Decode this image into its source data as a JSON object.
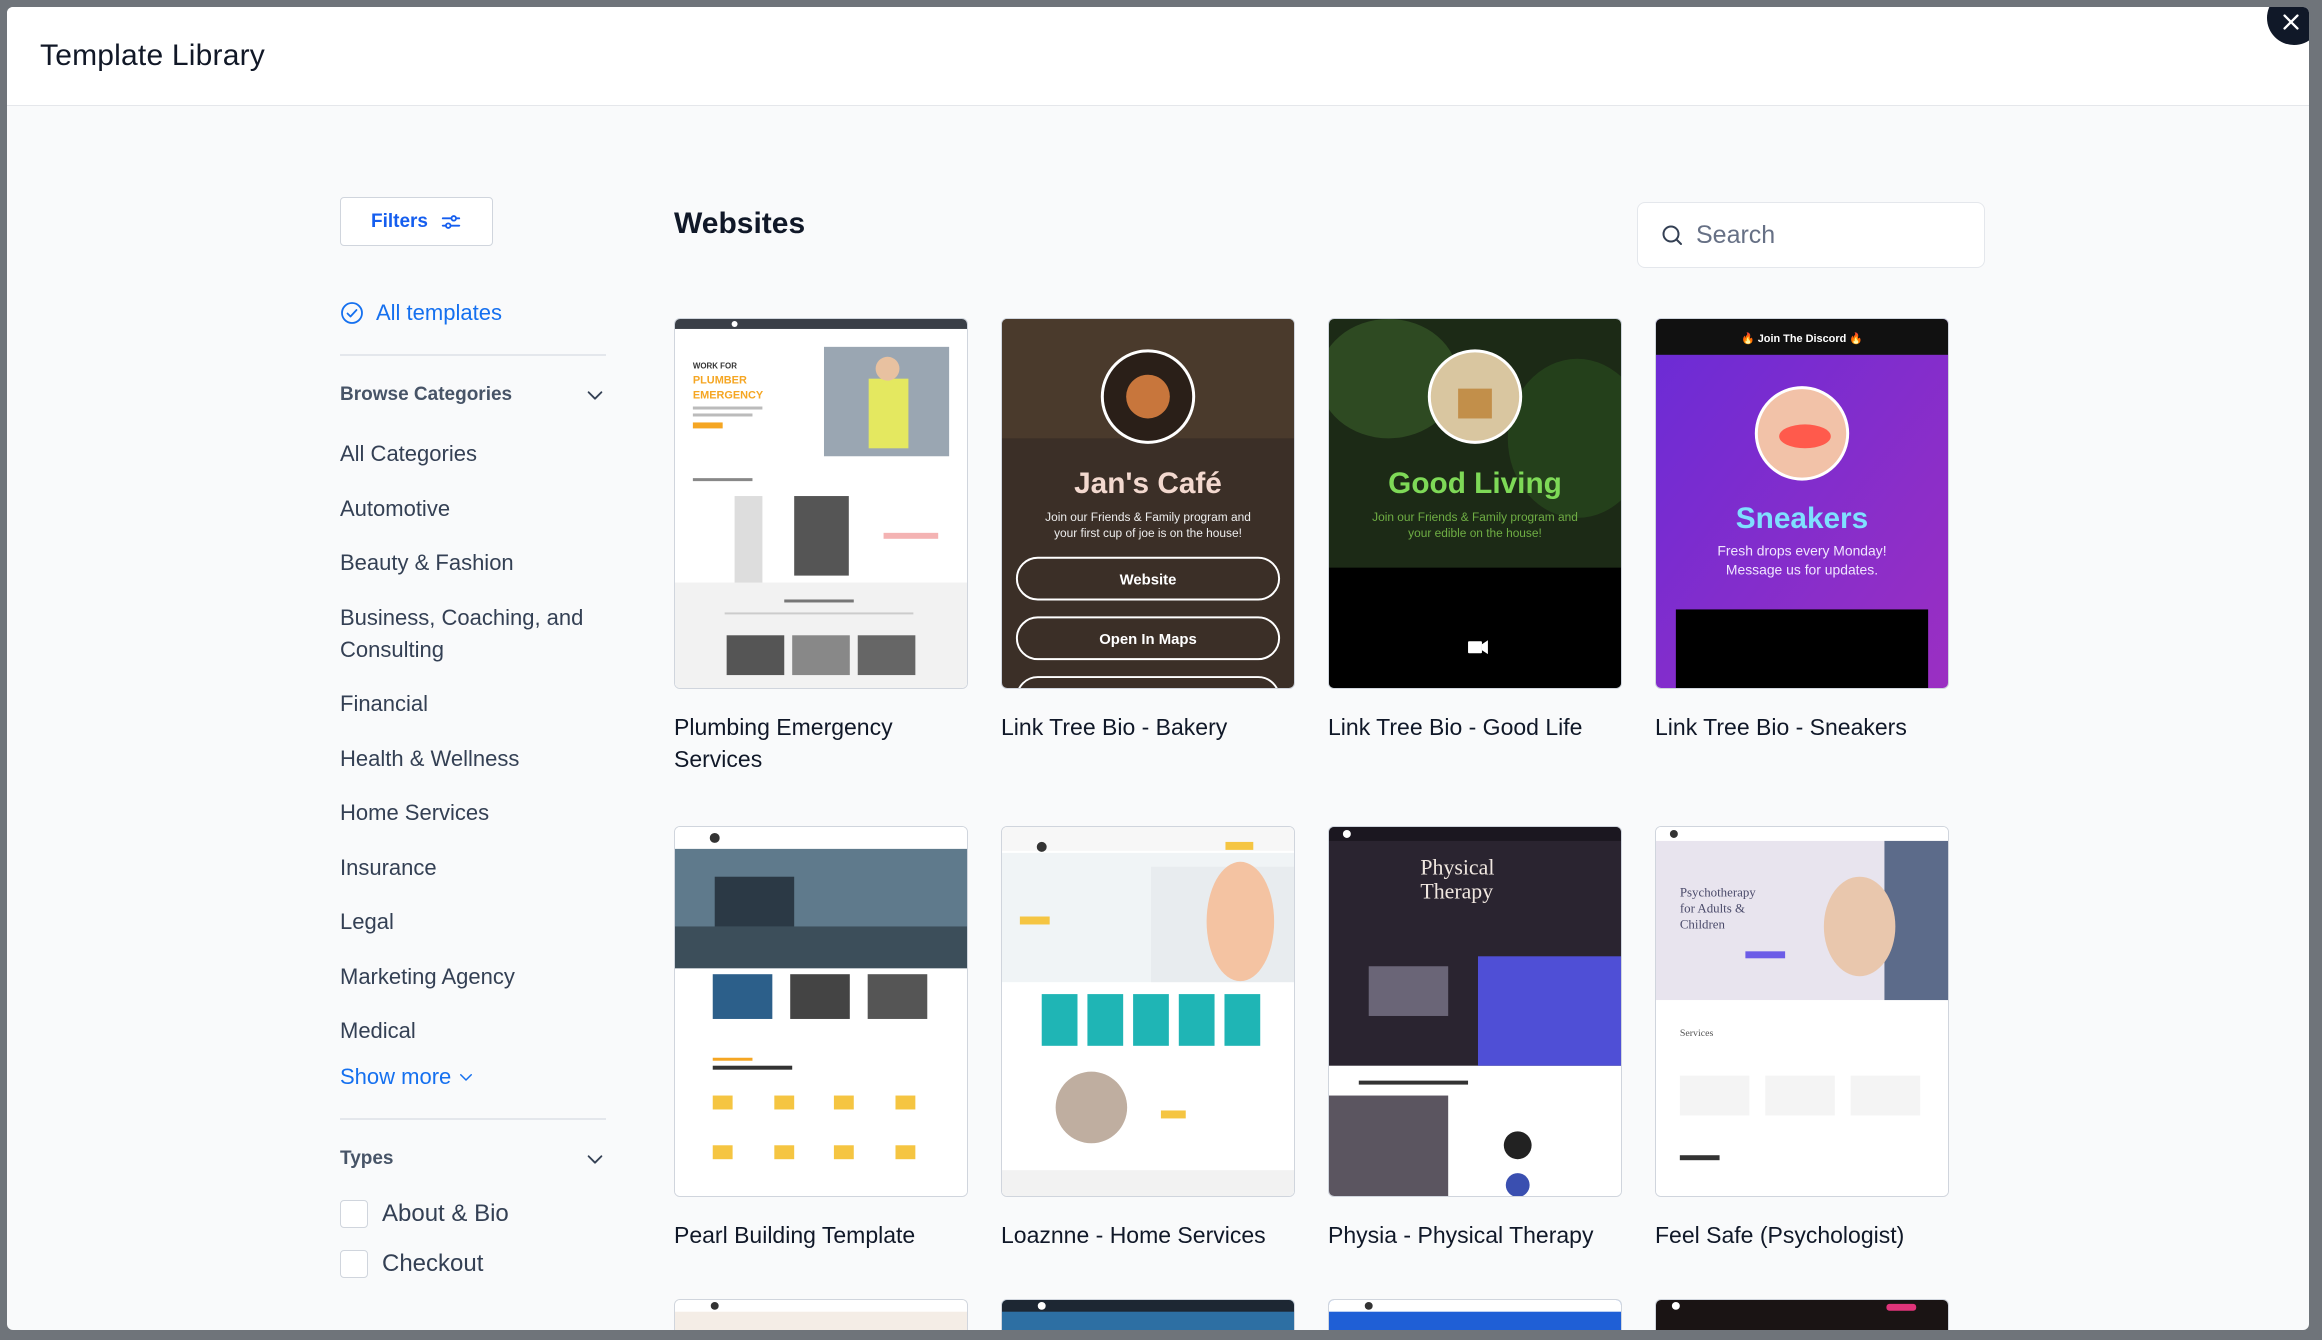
{
  "modal": {
    "title": "Template Library"
  },
  "sidebar": {
    "filters_label": "Filters",
    "all_templates_label": "All templates",
    "browse_categories_label": "Browse Categories",
    "categories": [
      "All Categories",
      "Automotive",
      "Beauty & Fashion",
      "Business, Coaching, and Consulting",
      "Financial",
      "Health & Wellness",
      "Home Services",
      "Insurance",
      "Legal",
      "Marketing Agency",
      "Medical"
    ],
    "show_more_label": "Show more",
    "types_label": "Types",
    "types": [
      "About & Bio",
      "Checkout"
    ]
  },
  "main": {
    "section_title": "Websites",
    "search_placeholder": "Search",
    "templates": [
      {
        "title": "Plumbing Emergency Services",
        "thumb_text": [
          "WORK FOR",
          "PLUMBER",
          "EMERGENCY"
        ]
      },
      {
        "title": "Link Tree Bio - Bakery",
        "thumb_text": [
          "Jan's Café",
          "Join our Friends & Family program and",
          "your first cup of joe is on the house!",
          "Website",
          "Open In Maps"
        ]
      },
      {
        "title": "Link Tree Bio - Good Life",
        "thumb_text": [
          "Good Living",
          "Join our Friends & Family program and",
          "your edible on the house!"
        ]
      },
      {
        "title": "Link Tree Bio - Sneakers",
        "thumb_text": [
          "🔥 Join The Discord 🔥",
          "Sneakers",
          "Fresh drops every Monday!",
          "Message us for updates."
        ]
      },
      {
        "title": "Pearl Building Template",
        "thumb_text": []
      },
      {
        "title": "Loaznne - Home Services",
        "thumb_text": []
      },
      {
        "title": "Physia - Physical Therapy",
        "thumb_text": [
          "Physical",
          "Therapy"
        ]
      },
      {
        "title": "Feel Safe (Psychologist)",
        "thumb_text": [
          "Psychotherapy",
          "for Adults &",
          "Children",
          "Services"
        ]
      }
    ]
  },
  "colors": {
    "accent": "#1570ef",
    "sneakers_bg": "#7b2cbf",
    "good_living_text": "#7ed957",
    "close_bg": "#101828"
  },
  "icons": [
    "close-icon",
    "filters-sliders-icon",
    "check-circle-icon",
    "chevron-down-icon",
    "search-icon",
    "video-camera-icon"
  ]
}
